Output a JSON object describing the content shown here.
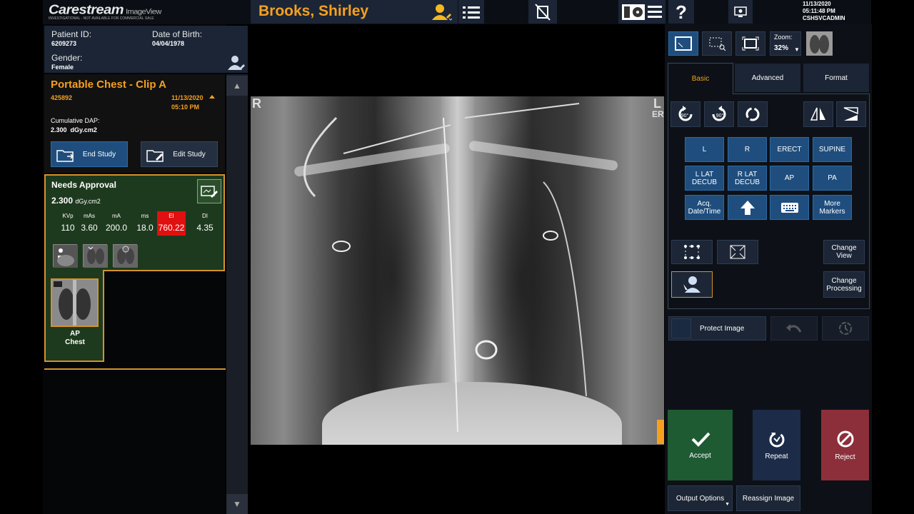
{
  "app": {
    "brand": "Carestream",
    "product": "ImageView",
    "disclaimer": "INVESTIGATIONAL - NOT AVAILABLE FOR COMMERCIAL SALE"
  },
  "header": {
    "patient_name": "Brooks, Shirley",
    "date": "11/13/2020",
    "time": "05:11:48 PM",
    "user": "CSHSVCADMIN"
  },
  "patient": {
    "id_label": "Patient ID:",
    "id": "6209273",
    "dob_label": "Date of Birth:",
    "dob": "04/04/1978",
    "gender_label": "Gender:",
    "gender": "Female"
  },
  "study": {
    "title": "Portable Chest - Clip A",
    "accession": "425892",
    "date": "11/13/2020",
    "time": "05:10 PM",
    "dap_label": "Cumulative DAP:",
    "dap_value": "2.300",
    "dap_unit": "dGy.cm2",
    "end_label": "End Study",
    "edit_label": "Edit Study"
  },
  "approval": {
    "title": "Needs Approval",
    "dose_value": "2.300",
    "dose_unit": "dGy.cm2",
    "params": [
      {
        "label": "KVp",
        "value": "110"
      },
      {
        "label": "mAs",
        "value": "3.60"
      },
      {
        "label": "mA",
        "value": "200.0"
      },
      {
        "label": "ms",
        "value": "18.0"
      },
      {
        "label": "EI",
        "value": "760.22"
      },
      {
        "label": "DI",
        "value": "4.35"
      }
    ],
    "ei_color": "#e01010",
    "thumb_label_1": "AP",
    "thumb_label_2": "Chest"
  },
  "viewer": {
    "marker_left": "R",
    "marker_right": "L",
    "marker_right_sub": "ER"
  },
  "tools": {
    "zoom_label": "Zoom:",
    "zoom_value": "32%"
  },
  "tabs": [
    "Basic",
    "Advanced",
    "Format"
  ],
  "rotate": {
    "left": "90°",
    "right": "90°"
  },
  "markers": [
    "L",
    "R",
    "ERECT",
    "SUPINE",
    "L LAT DECUB",
    "R LAT DECUB",
    "AP",
    "PA",
    "Acq. Date/Time",
    "More Markers"
  ],
  "change_view": "Change View",
  "change_processing": "Change Processing",
  "protect_image": "Protect Image",
  "actions": {
    "accept": "Accept",
    "repeat": "Repeat",
    "reject": "Reject",
    "output": "Output Options",
    "reassign": "Reassign Image"
  },
  "colors": {
    "accent": "#f5a020",
    "panel": "#1b2535",
    "button": "#1f4e7e",
    "accept": "#1e5a32",
    "reject": "#8c2f3a",
    "approval_bg": "#1e3a1e"
  }
}
